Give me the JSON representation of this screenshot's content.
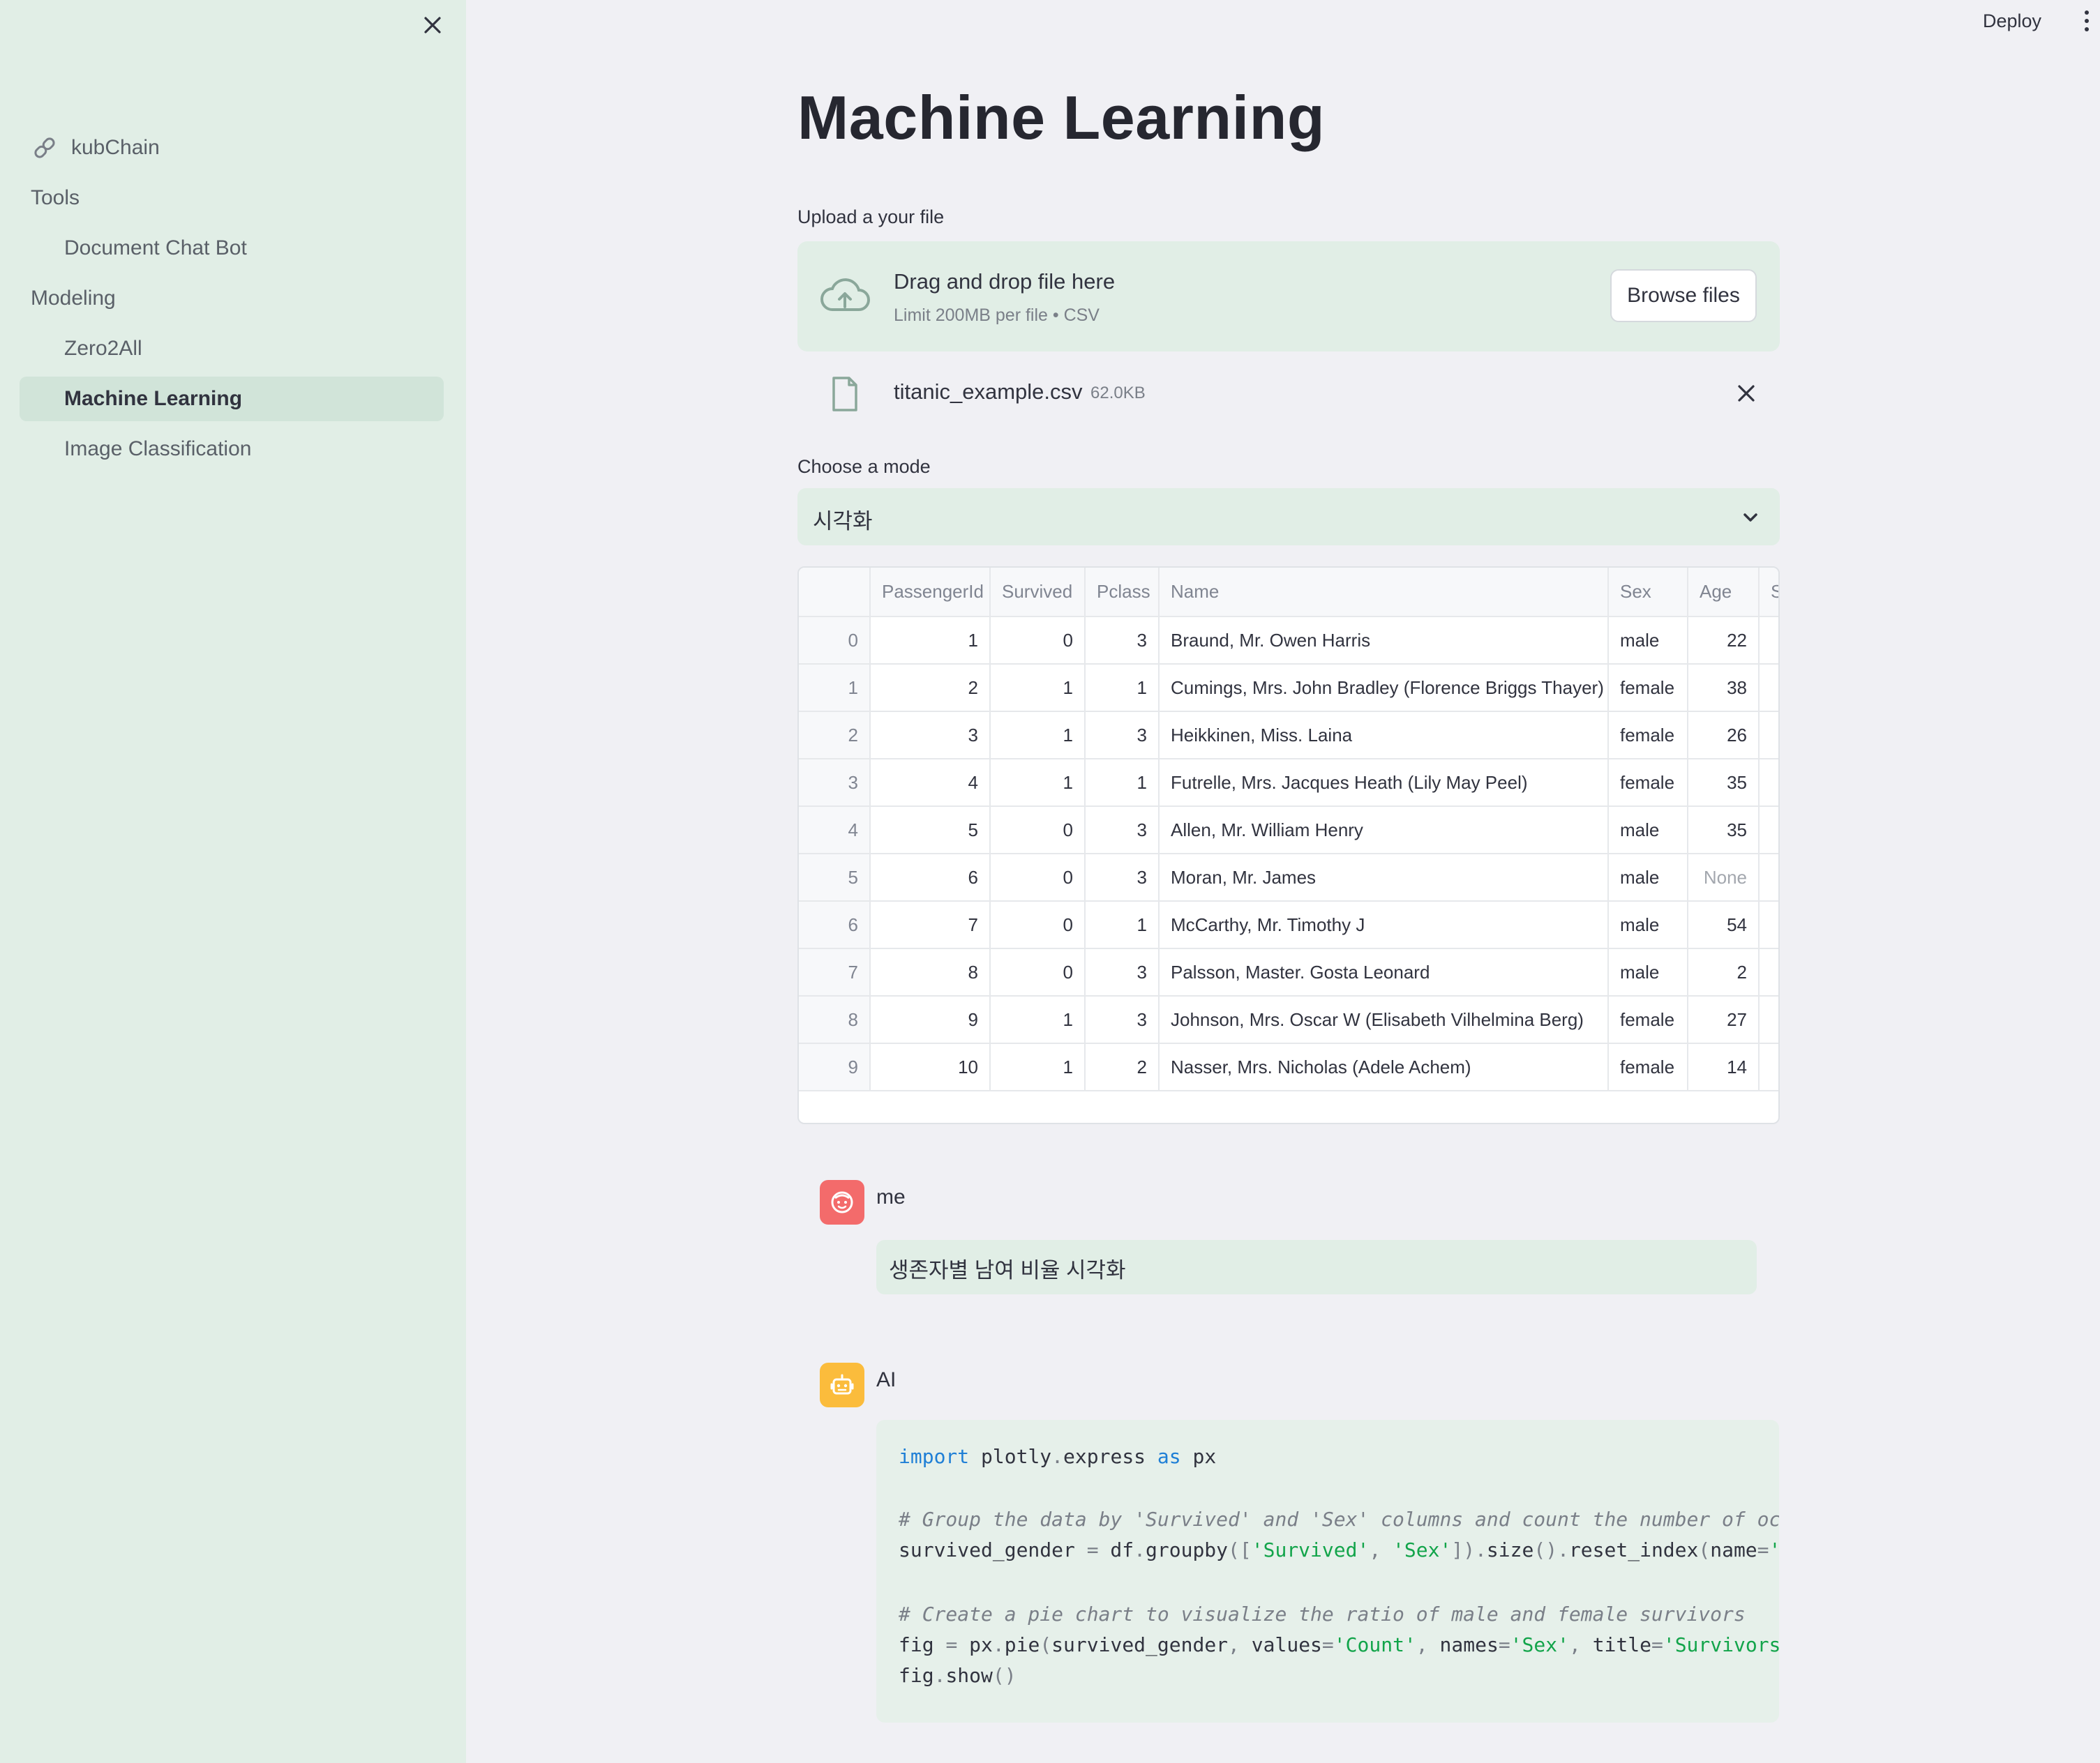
{
  "sidebar": {
    "brand": "kubChain",
    "sections": [
      {
        "label": "Tools"
      },
      {
        "label": "Document Chat Bot"
      },
      {
        "label": "Modeling"
      },
      {
        "label": "Zero2All"
      },
      {
        "label": "Machine Learning"
      },
      {
        "label": "Image Classification"
      }
    ],
    "active_item": "Machine Learning"
  },
  "header": {
    "deploy_label": "Deploy"
  },
  "main": {
    "title": "Machine Learning",
    "upload": {
      "label": "Upload a your file",
      "drop_title": "Drag and drop file here",
      "drop_sub": "Limit 200MB per file • CSV",
      "browse_label": "Browse files",
      "file_name": "titanic_example.csv",
      "file_size": "62.0KB"
    },
    "mode": {
      "label": "Choose a mode",
      "selected": "시각화"
    },
    "table": {
      "columns": [
        "PassengerId",
        "Survived",
        "Pclass",
        "Name",
        "Sex",
        "Age",
        "S"
      ],
      "rows": [
        [
          "0",
          "1",
          "0",
          "3",
          "Braund, Mr. Owen Harris",
          "male",
          "22"
        ],
        [
          "1",
          "2",
          "1",
          "1",
          "Cumings, Mrs. John Bradley (Florence Briggs Thayer)",
          "female",
          "38"
        ],
        [
          "2",
          "3",
          "1",
          "3",
          "Heikkinen, Miss. Laina",
          "female",
          "26"
        ],
        [
          "3",
          "4",
          "1",
          "1",
          "Futrelle, Mrs. Jacques Heath (Lily May Peel)",
          "female",
          "35"
        ],
        [
          "4",
          "5",
          "0",
          "3",
          "Allen, Mr. William Henry",
          "male",
          "35"
        ],
        [
          "5",
          "6",
          "0",
          "3",
          "Moran, Mr. James",
          "male",
          "None"
        ],
        [
          "6",
          "7",
          "0",
          "1",
          "McCarthy, Mr. Timothy J",
          "male",
          "54"
        ],
        [
          "7",
          "8",
          "0",
          "3",
          "Palsson, Master. Gosta Leonard",
          "male",
          "2"
        ],
        [
          "8",
          "9",
          "1",
          "3",
          "Johnson, Mrs. Oscar W (Elisabeth Vilhelmina Berg)",
          "female",
          "27"
        ],
        [
          "9",
          "10",
          "1",
          "2",
          "Nasser, Mrs. Nicholas (Adele Achem)",
          "female",
          "14"
        ]
      ]
    },
    "chat": {
      "user": {
        "author": "me",
        "message": "생존자별 남여 비율 시각화"
      },
      "ai": {
        "author": "AI",
        "code": {
          "l1_kw": "import",
          "l1_a": " plotly",
          "l1_dot": ".",
          "l1_b": "express ",
          "l1_as": "as",
          "l1_c": " px",
          "l2": "# Group the data by 'Survived' and 'Sex' columns and count the number of occurrences",
          "l3_a": "survived_gender ",
          "l3_eq": "=",
          "l3_b": " df",
          "l3_d1": ".",
          "l3_c": "groupby",
          "l3_p1": "([",
          "l3_s1": "'Survived'",
          "l3_cm": ", ",
          "l3_s2": "'Sex'",
          "l3_p2": "]).",
          "l3_e": "size",
          "l3_p3": "().",
          "l3_f": "reset_index",
          "l3_p4": "(",
          "l3_g": "name",
          "l3_eq2": "=",
          "l3_s3": "'Count')",
          "l4": "# Create a pie chart to visualize the ratio of male and female survivors",
          "l5_a": "fig ",
          "l5_eq": "=",
          "l5_b": " px",
          "l5_d": ".",
          "l5_c": "pie",
          "l5_p": "(",
          "l5_d2": "survived_gender",
          "l5_cm": ", ",
          "l5_e": "values",
          "l5_eq2": "=",
          "l5_s1": "'Count'",
          "l5_cm2": ", ",
          "l5_f": "names",
          "l5_eq3": "=",
          "l5_s2": "'Sex'",
          "l5_cm3": ", ",
          "l5_g": "title",
          "l5_eq4": "=",
          "l5_s3": "'Survivors by Gender')",
          "l6_a": "fig",
          "l6_d": ".",
          "l6_b": "show",
          "l6_p": "()"
        }
      }
    }
  },
  "colors": {
    "sidebar_bg": "#e1eee6",
    "user_avatar": "#f36b6b",
    "ai_avatar": "#fbbc3c",
    "keyword": "#1f7fd6",
    "string": "#12a44a"
  }
}
